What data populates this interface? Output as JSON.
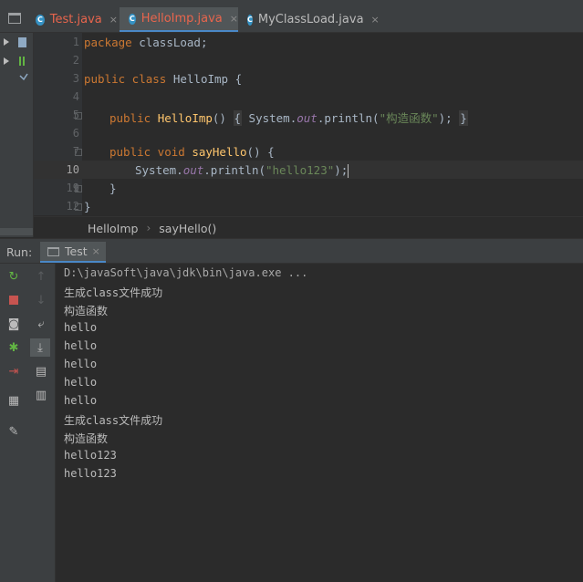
{
  "tabs": [
    {
      "label": "Test.java",
      "state": "normal-red"
    },
    {
      "label": "HelloImp.java",
      "state": "active"
    },
    {
      "label": "MyClassLoad.java",
      "state": "normal"
    }
  ],
  "tab_close": "×",
  "line_numbers": [
    "1",
    "2",
    "3",
    "4",
    "5",
    "6",
    "7",
    "8",
    "9",
    "10",
    "11",
    "12"
  ],
  "code": {
    "l1_kw": "package",
    "l1_rest": " classLoad;",
    "l3_kw": "public class",
    "l3_rest": " HelloImp {",
    "l5_kw": "public",
    "l5_fn": "HelloImp",
    "l5_paren": "()",
    "l5_open": "{",
    "l5_sys": " System.",
    "l5_out": "out",
    "l5_println": ".println(",
    "l5_str": "\"构造函数\"",
    "l5_end": "); ",
    "l5_close": "}",
    "l9_kw": "public void",
    "l9_fn": "sayHello",
    "l9_rest": "() {",
    "l10_sys": "System.",
    "l10_out": "out",
    "l10_println": ".println(",
    "l10_str": "\"hello123\"",
    "l10_end": ");",
    "l11": "}",
    "l12": "}"
  },
  "breadcrumb": {
    "class": "HelloImp",
    "sep": "›",
    "method": "sayHello()"
  },
  "run": {
    "label": "Run:",
    "tab": "Test",
    "close": "×"
  },
  "console": [
    "D:\\javaSoft\\java\\jdk\\bin\\java.exe ...",
    "生成class文件成功",
    "构造函数",
    "hello",
    "hello",
    "hello",
    "hello",
    "hello",
    "生成class文件成功",
    "构造函数",
    "hello123",
    "hello123"
  ],
  "colors": {
    "accent": "#4a88c7",
    "keyword": "#cc7832",
    "method": "#ffc66d",
    "string": "#6a8759",
    "field": "#9876aa",
    "tab_error": "#e8654d"
  }
}
